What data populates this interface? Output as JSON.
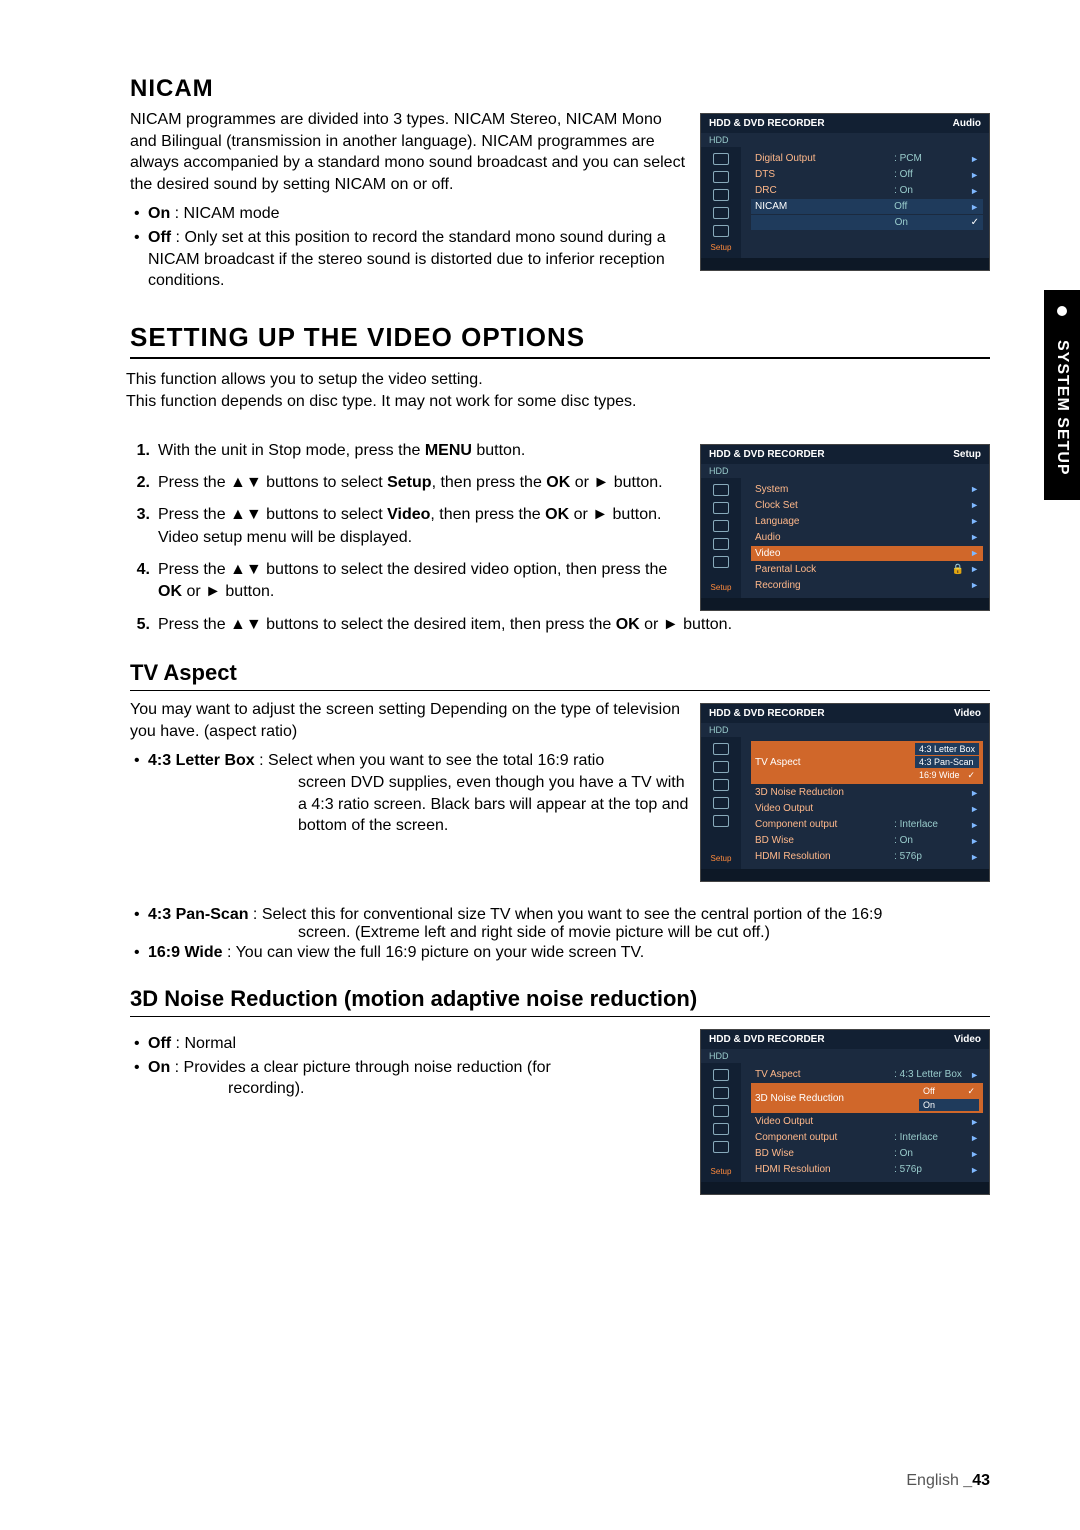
{
  "side_tab": "SYSTEM SETUP",
  "nicam": {
    "title": "NICAM",
    "intro": "NICAM programmes are divided into 3 types. NICAM Stereo, NICAM Mono and Bilingual (transmission in another language). NICAM programmes are always accompanied by a standard mono sound broadcast and you can select the desired sound by setting NICAM on or off.",
    "on_label": "On",
    "on_desc": " : NICAM mode",
    "off_label": "Off",
    "off_desc": " : Only set at this position to record the standard mono sound during a NICAM broadcast if the stereo sound is distorted due to inferior reception conditions."
  },
  "video_section": {
    "title": "SETTING UP THE VIDEO OPTIONS",
    "intro1": "This function allows you to setup the video setting.",
    "intro2": "This function depends on disc type. It may not work for some disc types.",
    "steps": {
      "s1_a": "With the unit in Stop mode, press the ",
      "s1_b": "MENU",
      "s1_c": " button.",
      "s2_a": "Press the ▲▼ buttons to select ",
      "s2_b": "Setup",
      "s2_c": ", then press the ",
      "s2_d": "OK",
      "s2_e": " or ► button.",
      "s3_a": "Press the ▲▼ buttons to select ",
      "s3_b": "Video",
      "s3_c": ", then press the ",
      "s3_d": "OK",
      "s3_e": " or ► button.",
      "s3_note": "Video setup menu will be displayed.",
      "s4_a": "Press the ▲▼ buttons to select the desired video option, then press the ",
      "s4_b": "OK",
      "s4_c": " or ► button.",
      "s5_a": "Press the ▲▼ buttons to select the desired item, then press the ",
      "s5_b": "OK",
      "s5_c": " or ► button."
    }
  },
  "tv_aspect": {
    "title": "TV Aspect",
    "intro": "You may want to adjust the screen setting Depending on the type of television you have. (aspect ratio)",
    "lb_label": "4:3 Letter Box",
    "lb_desc1": " : Select when you want to see the total 16:9 ratio",
    "lb_desc2": "screen DVD supplies, even though you have a TV with a 4:3 ratio screen. Black bars will appear at the top and bottom of the screen.",
    "ps_label": "4:3 Pan-Scan",
    "ps_desc1": " : Select this for conventional size TV when you want to see the central portion of the 16:9",
    "ps_desc2": "screen. (Extreme left and right side of movie picture will be cut off.)",
    "wide_label": "16:9 Wide",
    "wide_desc": " : You can view the full 16:9 picture on your wide screen TV."
  },
  "noise": {
    "title": "3D Noise Reduction (motion adaptive noise reduction)",
    "off_label": "Off",
    "off_desc": " : Normal",
    "on_label": "On",
    "on_desc1": " : Provides a clear picture through noise reduction (for",
    "on_desc2": "recording)."
  },
  "osd_common": {
    "header": "HDD & DVD RECORDER",
    "hdd": "HDD",
    "setup": "Setup"
  },
  "osd1": {
    "title_right": "Audio",
    "rows": [
      {
        "label": "Digital Output",
        "val": ": PCM"
      },
      {
        "label": "DTS",
        "val": ": Off"
      },
      {
        "label": "DRC",
        "val": ": On"
      },
      {
        "label": "NICAM",
        "val": "Off",
        "sel": true
      },
      {
        "label": "",
        "val": "On",
        "check": true
      }
    ]
  },
  "osd2": {
    "title_right": "Setup",
    "rows": [
      {
        "label": "System"
      },
      {
        "label": "Clock Set"
      },
      {
        "label": "Language"
      },
      {
        "label": "Audio"
      },
      {
        "label": "Video",
        "sel": true
      },
      {
        "label": "Parental Lock",
        "lock": true
      },
      {
        "label": "Recording"
      }
    ]
  },
  "osd3": {
    "title_right": "Video",
    "rows": [
      {
        "label": "TV Aspect",
        "opts": [
          "4:3 Letter Box",
          "4:3 Pan-Scan",
          "16:9 Wide"
        ],
        "sel": true,
        "optSel": 2
      },
      {
        "label": "3D Noise Reduction"
      },
      {
        "label": "Video Output"
      },
      {
        "label": "Component output",
        "val": ": Interlace"
      },
      {
        "label": "BD Wise",
        "val": ": On"
      },
      {
        "label": "HDMI Resolution",
        "val": ": 576p"
      }
    ]
  },
  "osd4": {
    "title_right": "Video",
    "rows": [
      {
        "label": "TV Aspect",
        "val": ": 4:3 Letter Box"
      },
      {
        "label": "3D Noise Reduction",
        "opts": [
          "Off",
          "On"
        ],
        "sel": true,
        "optSel": 0
      },
      {
        "label": "Video Output"
      },
      {
        "label": "Component output",
        "val": ": Interlace"
      },
      {
        "label": "BD Wise",
        "val": ": On"
      },
      {
        "label": "HDMI Resolution",
        "val": ": 576p"
      }
    ]
  },
  "footer": {
    "lang": "English ",
    "page": "_43"
  }
}
